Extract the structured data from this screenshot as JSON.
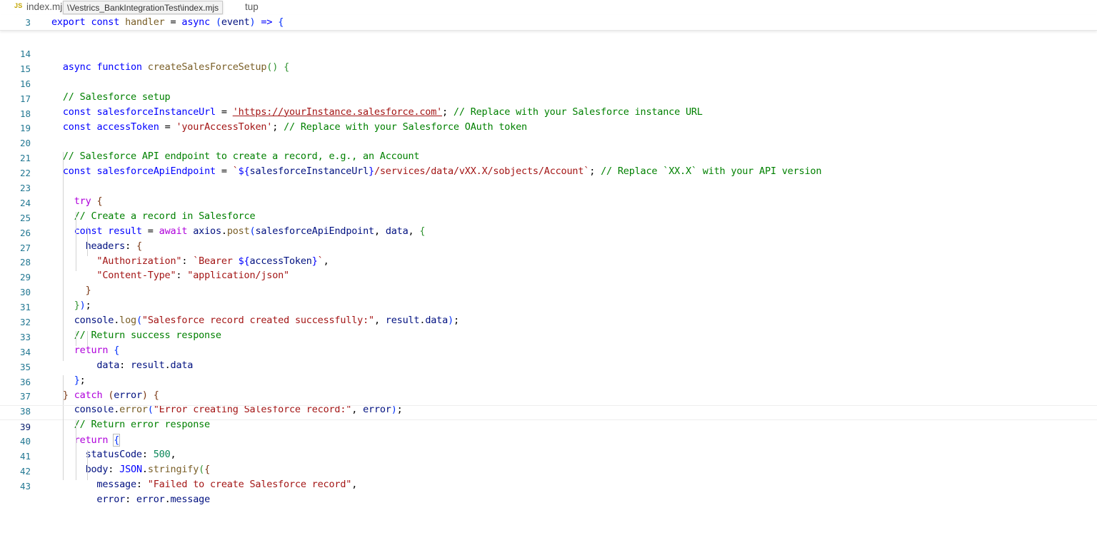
{
  "breadcrumb": {
    "lang_badge": "JS",
    "file": "index.mj",
    "rest": "tup",
    "tooltip": "\\Vestrics_BankIntegrationTest\\index.mjs"
  },
  "sticky": {
    "line_number": "3"
  },
  "lines": [
    {
      "n": "14"
    },
    {
      "n": "15"
    },
    {
      "n": "16"
    },
    {
      "n": "17"
    },
    {
      "n": "18"
    },
    {
      "n": "19"
    },
    {
      "n": "20"
    },
    {
      "n": "21"
    },
    {
      "n": "22"
    },
    {
      "n": "23"
    },
    {
      "n": "24"
    },
    {
      "n": "25"
    },
    {
      "n": "26"
    },
    {
      "n": "27"
    },
    {
      "n": "28"
    },
    {
      "n": "29"
    },
    {
      "n": "30"
    },
    {
      "n": "31"
    },
    {
      "n": "32"
    },
    {
      "n": "33"
    },
    {
      "n": "34"
    },
    {
      "n": "35"
    },
    {
      "n": "36"
    },
    {
      "n": "37"
    },
    {
      "n": "38"
    },
    {
      "n": "39"
    },
    {
      "n": "40"
    },
    {
      "n": "41"
    },
    {
      "n": "42"
    },
    {
      "n": "43"
    }
  ],
  "t": {
    "export": "export",
    "const": "const",
    "async": "async",
    "function": "function",
    "try": "try",
    "await": "await",
    "return": "return",
    "catch": "catch",
    "handler": "handler",
    "event": "event",
    "createSalesForceSetup": "createSalesForceSetup",
    "salesforceInstanceUrl": "salesforceInstanceUrl",
    "accessToken": "accessToken",
    "salesforceApiEndpoint": "salesforceApiEndpoint",
    "result": "result",
    "axios": "axios",
    "post": "post",
    "data": "data",
    "headers": "headers",
    "console": "console",
    "log": "log",
    "error_fn": "error",
    "error": "error",
    "statusCode": "statusCode",
    "body": "body",
    "JSON": "JSON",
    "stringify": "stringify",
    "message": "message",
    "data_prop": "data",
    "url_string": "'https://yourInstance.salesforce.com'",
    "token_string": "'yourAccessToken'",
    "auth_key": "\"Authorization\"",
    "ct_key": "\"Content-Type\"",
    "ct_val": "\"application/json\"",
    "log_msg": "\"Salesforce record created successfully:\"",
    "err_msg": "\"Error creating Salesforce record:\"",
    "fail_msg": "\"Failed to create Salesforce record\"",
    "num_500": "500",
    "tpl_bearer_start": "`Bearer ",
    "tpl_end": "`",
    "tpl_start": "`",
    "tpl_path": "/services/data/vXX.X/sobjects/Account`",
    "cm_setup": "// Salesforce setup",
    "cm_replace_url": "// Replace with your Salesforce instance URL",
    "cm_replace_token": "// Replace with your Salesforce OAuth token",
    "cm_endpoint": "// Salesforce API endpoint to create a record, e.g., an Account",
    "cm_version": "// Replace `XX.X` with your API version",
    "cm_create": "// Create a record in Salesforce",
    "cm_success": "// Return success response",
    "cm_error": "// Return error response"
  }
}
